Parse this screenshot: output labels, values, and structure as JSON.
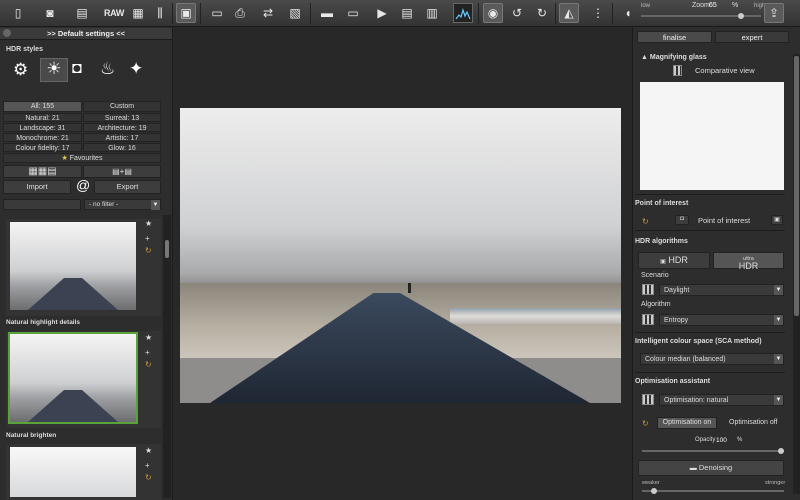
{
  "toolbar": {
    "raw_label": "RAW",
    "zoom_label": "Zoom",
    "zoom_value": "65",
    "zoom_unit": "%",
    "low_label": "low",
    "high_label": "high"
  },
  "left": {
    "header": ">> Default settings <<",
    "section": "HDR styles",
    "styles": [
      {
        "label": "All: 155",
        "selected": true
      },
      {
        "label": "Custom"
      },
      {
        "label": "Natural: 21"
      },
      {
        "label": "Surreal: 13"
      },
      {
        "label": "Landscape: 31"
      },
      {
        "label": "Architecture: 19"
      },
      {
        "label": "Monochrome: 21"
      },
      {
        "label": "Artistic: 17"
      },
      {
        "label": "Colour fidelity: 17"
      },
      {
        "label": "Glow: 16"
      }
    ],
    "favourites": "Favourites",
    "import": "Import",
    "export": "Export",
    "at": "@",
    "filter": "- no filter -",
    "presets": [
      "Natural highlight details",
      "Natural brighten"
    ]
  },
  "right": {
    "tab_finalise": "finalise",
    "tab_expert": "expert",
    "magnifier": "Magnifying glass",
    "comparative": "Comparative view",
    "poi_section": "Point of interest",
    "poi_button": "Point of interest",
    "algo_section": "HDR algorithms",
    "hdr": "HDR",
    "ultra": "ultra",
    "ultra_hdr": "HDR",
    "scenario_label": "Scenario",
    "scenario_value": "Daylight",
    "algorithm_label": "Algorithm",
    "algorithm_value": "Entropy",
    "colour_section": "Intelligent colour space (SCA method)",
    "colour_value": "Colour median (balanced)",
    "opt_section": "Optimisation assistant",
    "opt_value": "Optimisation: natural",
    "opt_on": "Optimisation on",
    "opt_off": "Optimisation off",
    "opacity_label": "Opacity",
    "opacity_value": "100",
    "opacity_unit": "%",
    "denoise": "Denoising",
    "weaker": "weaker",
    "stronger": "stronger"
  }
}
